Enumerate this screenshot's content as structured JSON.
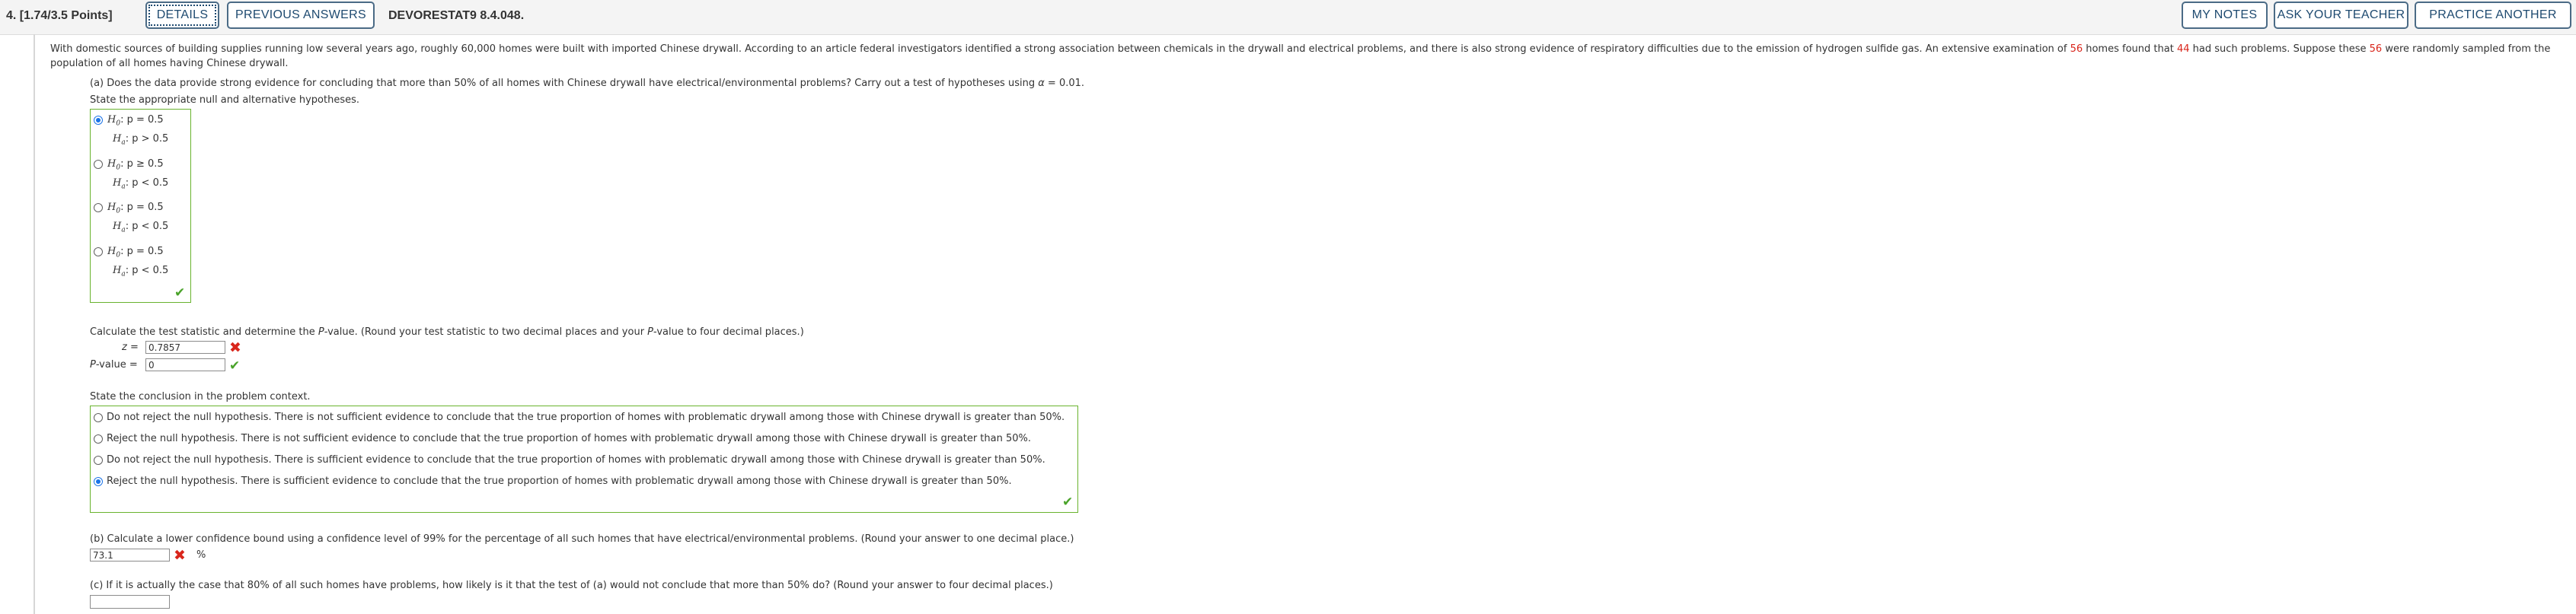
{
  "header": {
    "question_number": "4.",
    "points": "[1.74/3.5 Points]",
    "details_label": "DETAILS",
    "previous_answers_label": "PREVIOUS ANSWERS",
    "question_code": "DEVORESTAT9 8.4.048.",
    "my_notes_label": "MY NOTES",
    "ask_teacher_label": "ASK YOUR TEACHER",
    "practice_another_label": "PRACTICE ANOTHER"
  },
  "intro": {
    "part1": "With domestic sources of building supplies running low several years ago, roughly 60,000 homes were built with imported Chinese drywall. According to an article federal investigators identified a strong association between chemicals in the drywall and electrical problems, and there is also strong evidence of respiratory difficulties due to the emission of hydrogen sulfide gas. An extensive examination of ",
    "n_total": "56",
    "part2": " homes found that ",
    "n_problem": "44",
    "part3": " had such problems. Suppose these ",
    "n_sample": "56",
    "part4": " were randomly sampled from the",
    "line2": "population of all homes having Chinese drywall."
  },
  "part_a": {
    "question_prefix": "(a) Does the data provide strong evidence for concluding that more than 50% of all homes with Chinese drywall have electrical/environmental problems? Carry out a test of hypotheses using ",
    "alpha_symbol": "α",
    "alpha_value": " = 0.01.",
    "state_hyp": "State the appropriate null and alternative hypotheses.",
    "hypotheses": [
      {
        "h0_op": ": p = 0.5",
        "ha_op": ": p > 0.5",
        "selected": true
      },
      {
        "h0_op": ": p ≥ 0.5",
        "ha_op": ": p < 0.5",
        "selected": false
      },
      {
        "h0_op": ": p = 0.5",
        "ha_op": ": p < 0.5",
        "selected": false
      },
      {
        "h0_op": ": p = 0.5",
        "ha_op": ": p < 0.5",
        "selected": false
      }
    ],
    "h0_label": "H",
    "h0_sub": "0",
    "ha_label": "H",
    "ha_sub": "a",
    "calc_prefix": "Calculate the test statistic and determine the ",
    "calc_pvalue_word": "P",
    "calc_suffix": "-value. (Round your test statistic to two decimal places and your ",
    "calc_pvalue_word2": "P",
    "calc_suffix2": "-value to four decimal places.)",
    "z_label": "z",
    "z_equals": " =",
    "z_value": "0.7857",
    "p_label": "P",
    "p_label_rest": "-value  =",
    "p_value": "0",
    "conclusion_prompt": "State the conclusion in the problem context.",
    "conclusions": [
      {
        "text": "Do not reject the null hypothesis. There is not sufficient evidence to conclude that the true proportion of homes with problematic drywall among those with Chinese drywall is greater than 50%.",
        "selected": false
      },
      {
        "text": "Reject the null hypothesis. There is not sufficient evidence to conclude that the true proportion of homes with problematic drywall among those with Chinese drywall is greater than 50%.",
        "selected": false
      },
      {
        "text": "Do not reject the null hypothesis. There is sufficient evidence to conclude that the true proportion of homes with problematic drywall among those with Chinese drywall is greater than 50%.",
        "selected": false
      },
      {
        "text": "Reject the null hypothesis. There is sufficient evidence to conclude that the true proportion of homes with problematic drywall among those with Chinese drywall is greater than 50%.",
        "selected": true
      }
    ]
  },
  "part_b": {
    "question": "(b) Calculate a lower confidence bound using a confidence level of 99% for the percentage of all such homes that have electrical/environmental problems. (Round your answer to one decimal place.)",
    "answer": "73.1",
    "unit": "%"
  },
  "part_c": {
    "question": "(c) If it is actually the case that 80% of all such homes have problems, how likely is it that the test of (a) would not conclude that more than 50% do? (Round your answer to four decimal places.)",
    "answer": ""
  },
  "icons": {
    "correct": "✔",
    "incorrect": "✖"
  },
  "colors": {
    "correct_green": "#4aa32a",
    "incorrect_red": "#d9261c",
    "button_text": "#1e4a70",
    "highlight_red": "#d9261c"
  }
}
